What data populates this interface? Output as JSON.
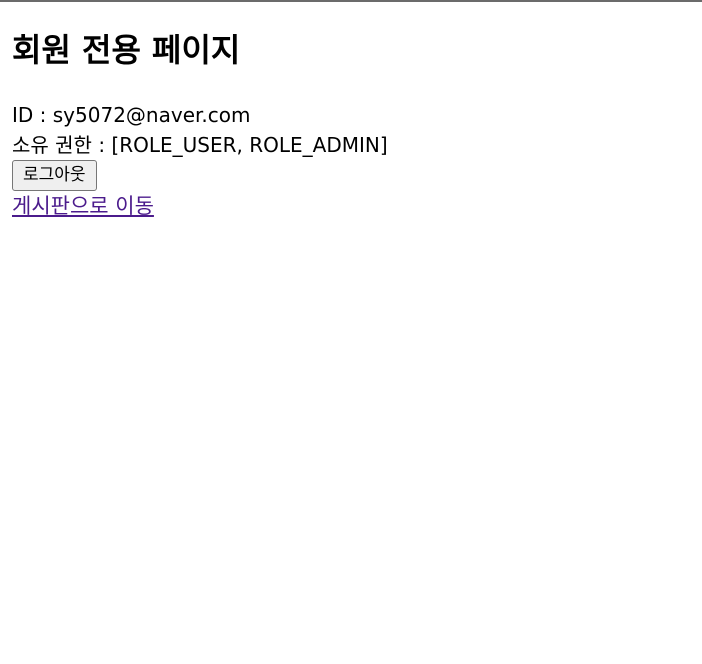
{
  "page": {
    "title": "회원 전용 페이지"
  },
  "user": {
    "id_label": "ID",
    "id_separator": " : ",
    "id_value": "sy5072@naver.com",
    "roles_label": "소유 권한",
    "roles_separator": " : ",
    "roles_value": "[ROLE_USER, ROLE_ADMIN]"
  },
  "actions": {
    "logout_label": "로그아웃",
    "board_link_label": "게시판으로 이동"
  },
  "colors": {
    "link_visited": "#4b1b8c",
    "button_bg": "#efefef",
    "top_border": "#6b6b6b"
  }
}
